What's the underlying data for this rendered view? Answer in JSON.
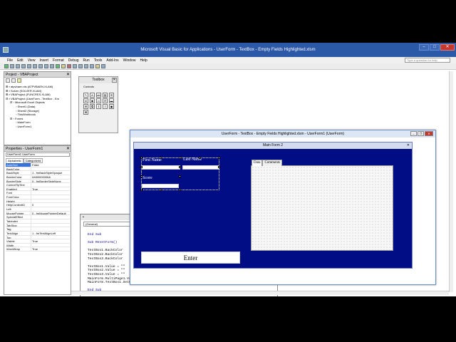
{
  "window": {
    "title": "Microsoft Visual Basic for Applications - UserForm - TextBox - Empty Fields Highlighted.xlsm"
  },
  "menu": [
    "File",
    "Edit",
    "View",
    "Insert",
    "Format",
    "Debug",
    "Run",
    "Tools",
    "Add-Ins",
    "Window",
    "Help"
  ],
  "help_placeholder": "Type a question for help",
  "project": {
    "title": "Project - VBAProject",
    "tree": [
      "atpvbaen.xls (ATPVBAEN.XLAM)",
      "Solver (SOLVER.XLAM)",
      "VBAProject (FUNCRES.XLAM)",
      "VBAProject (UserForm - TextBox - Em",
      "Microsoft Excel Objects",
      "Sheet1 (Data)",
      "Sheet2 (Storage)",
      "ThisWorkbook",
      "Forms",
      "MainForm",
      "UserForm1"
    ]
  },
  "properties": {
    "title": "Properties - UserForm1",
    "object": "UserForm1 UserForm",
    "tabs": [
      "Alphabetic",
      "Categorized"
    ],
    "rows": [
      {
        "name": "AutoSize",
        "value": "False"
      },
      {
        "name": "BackColor",
        "value": ""
      },
      {
        "name": "BackStyle",
        "value": "1 - fmBackStyleOpaque"
      },
      {
        "name": "BorderColor",
        "value": "&H80000006&"
      },
      {
        "name": "BorderStyle",
        "value": "0 - fmBorderStyleNone"
      },
      {
        "name": "ControlTipText",
        "value": ""
      },
      {
        "name": "Enabled",
        "value": "True"
      },
      {
        "name": "Font",
        "value": ""
      },
      {
        "name": "ForeColor",
        "value": ""
      },
      {
        "name": "Height",
        "value": ""
      },
      {
        "name": "HelpContextID",
        "value": "0"
      },
      {
        "name": "Left",
        "value": ""
      },
      {
        "name": "MousePointer",
        "value": "0 - fmMousePointerDefault"
      },
      {
        "name": "SpecialEffect",
        "value": ""
      },
      {
        "name": "TabIndex",
        "value": ""
      },
      {
        "name": "TabStop",
        "value": ""
      },
      {
        "name": "Tag",
        "value": ""
      },
      {
        "name": "TextAlign",
        "value": "1 - fmTextAlignLeft"
      },
      {
        "name": "Top",
        "value": ""
      },
      {
        "name": "Visible",
        "value": "True"
      },
      {
        "name": "Width",
        "value": ""
      },
      {
        "name": "WordWrap",
        "value": "True"
      }
    ]
  },
  "toolbox": {
    "title": "Toolbox",
    "tab": "Controls",
    "tools": [
      "pointer-tool",
      "label-tool",
      "textbox-tool",
      "combobox-tool",
      "listbox-tool",
      "checkbox-tool",
      "optionbutton-tool",
      "togglebutton-tool",
      "frame-tool",
      "commandbutton-tool",
      "tabstrip-tool",
      "multipage-tool",
      "scrollbar-tool",
      "spinbutton-tool",
      "image-tool",
      "refedit-tool"
    ]
  },
  "code": {
    "combo": "(General)",
    "lines": [
      "End Sub",
      "",
      "Sub ResetForm()",
      "",
      "TextBox1.BackColor",
      "TextBox2.BackColor",
      "TextBox3.BackColor",
      "",
      "TextBox1.Value = \"\"",
      "TextBox2.Value = \"\"",
      "TextBox3.Value = \"\"",
      "MainForm.MultiPage1.Value = 0",
      "MainForm.TextBox1.SetFocus",
      "",
      "End Sub"
    ]
  },
  "designer": {
    "title": "UserForm - TextBox - Empty Fields Highlighted.xlsm - UserForm1 (UserForm)"
  },
  "form": {
    "title": "Main Form 2",
    "first_name_label": "First Name",
    "last_name_label": "Last Name",
    "score_label": "Score",
    "enter_button": "Enter",
    "tabs": [
      "Data",
      "Comments"
    ]
  },
  "colors": {
    "form_background": "#000d85",
    "title_bar": "#2c58a8"
  }
}
